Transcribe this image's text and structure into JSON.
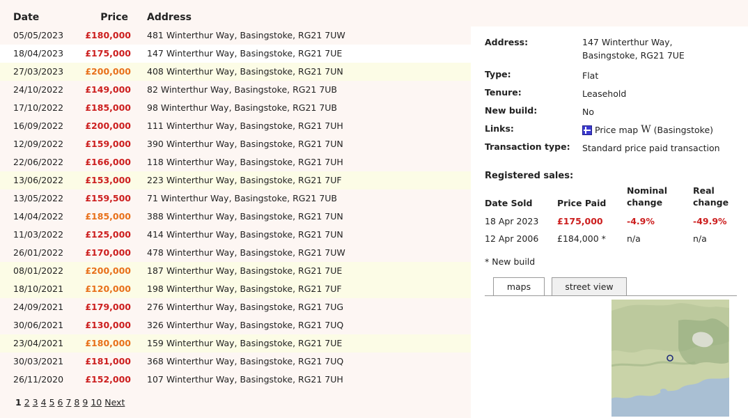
{
  "table": {
    "headers": {
      "date": "Date",
      "price": "Price",
      "address": "Address"
    },
    "rows": [
      {
        "date": "05/05/2023",
        "price": "£180,000",
        "address": "481 Winterthur Way, Basingstoke, RG21 7UW",
        "price_color": "red"
      },
      {
        "date": "18/04/2023",
        "price": "£175,000",
        "address": "147 Winterthur Way, Basingstoke, RG21 7UE",
        "price_color": "red"
      },
      {
        "date": "27/03/2023",
        "price": "£200,000",
        "address": "408 Winterthur Way, Basingstoke, RG21 7UN",
        "price_color": "orange"
      },
      {
        "date": "24/10/2022",
        "price": "£149,000",
        "address": "82 Winterthur Way, Basingstoke, RG21 7UB",
        "price_color": "red"
      },
      {
        "date": "17/10/2022",
        "price": "£185,000",
        "address": "98 Winterthur Way, Basingstoke, RG21 7UB",
        "price_color": "red"
      },
      {
        "date": "16/09/2022",
        "price": "£200,000",
        "address": "111 Winterthur Way, Basingstoke, RG21 7UH",
        "price_color": "red"
      },
      {
        "date": "12/09/2022",
        "price": "£159,000",
        "address": "390 Winterthur Way, Basingstoke, RG21 7UN",
        "price_color": "red"
      },
      {
        "date": "22/06/2022",
        "price": "£166,000",
        "address": "118 Winterthur Way, Basingstoke, RG21 7UH",
        "price_color": "red"
      },
      {
        "date": "13/06/2022",
        "price": "£153,000",
        "address": "223 Winterthur Way, Basingstoke, RG21 7UF",
        "price_color": "red"
      },
      {
        "date": "13/05/2022",
        "price": "£159,500",
        "address": "71 Winterthur Way, Basingstoke, RG21 7UB",
        "price_color": "red"
      },
      {
        "date": "14/04/2022",
        "price": "£185,000",
        "address": "388 Winterthur Way, Basingstoke, RG21 7UN",
        "price_color": "orange"
      },
      {
        "date": "11/03/2022",
        "price": "£125,000",
        "address": "414 Winterthur Way, Basingstoke, RG21 7UN",
        "price_color": "red"
      },
      {
        "date": "26/01/2022",
        "price": "£170,000",
        "address": "478 Winterthur Way, Basingstoke, RG21 7UW",
        "price_color": "red"
      },
      {
        "date": "08/01/2022",
        "price": "£200,000",
        "address": "187 Winterthur Way, Basingstoke, RG21 7UE",
        "price_color": "orange"
      },
      {
        "date": "18/10/2021",
        "price": "£120,000",
        "address": "198 Winterthur Way, Basingstoke, RG21 7UF",
        "price_color": "orange"
      },
      {
        "date": "24/09/2021",
        "price": "£179,000",
        "address": "276 Winterthur Way, Basingstoke, RG21 7UG",
        "price_color": "red"
      },
      {
        "date": "30/06/2021",
        "price": "£130,000",
        "address": "326 Winterthur Way, Basingstoke, RG21 7UQ",
        "price_color": "red"
      },
      {
        "date": "23/04/2021",
        "price": "£180,000",
        "address": "159 Winterthur Way, Basingstoke, RG21 7UE",
        "price_color": "orange"
      },
      {
        "date": "30/03/2021",
        "price": "£181,000",
        "address": "368 Winterthur Way, Basingstoke, RG21 7UQ",
        "price_color": "red"
      },
      {
        "date": "26/11/2020",
        "price": "£152,000",
        "address": "107 Winterthur Way, Basingstoke, RG21 7UH",
        "price_color": "red"
      }
    ],
    "selected_row_index": 1,
    "highlighted_row_indices": [
      2,
      8,
      13,
      14,
      17
    ]
  },
  "pagination": {
    "pages": [
      "1",
      "2",
      "3",
      "4",
      "5",
      "6",
      "7",
      "8",
      "9",
      "10"
    ],
    "current": "1",
    "next_label": "Next"
  },
  "detail": {
    "address_label": "Address:",
    "address_line1": "147 Winterthur Way,",
    "address_line2": "Basingstoke, RG21 7UE",
    "type_label": "Type:",
    "type_value": "Flat",
    "tenure_label": "Tenure:",
    "tenure_value": "Leasehold",
    "newbuild_label": "New build:",
    "newbuild_value": "No",
    "links_label": "Links:",
    "links_price_map": "Price map",
    "links_wiki": "(Basingstoke)",
    "wiki_glyph": "W",
    "transaction_label": "Transaction type:",
    "transaction_value": "Standard price paid transaction",
    "registered_sales_title": "Registered sales:",
    "sales_headers": {
      "date_sold": "Date Sold",
      "price_paid": "Price Paid",
      "nominal_1": "Nominal",
      "nominal_2": "change",
      "real_1": "Real",
      "real_2": "change"
    },
    "sales": [
      {
        "date": "18 Apr 2023",
        "price": "£175,000",
        "nominal": "-4.9%",
        "real": "-49.9%",
        "highlight": true
      },
      {
        "date": "12 Apr 2006",
        "price": "£184,000 *",
        "nominal": "n/a",
        "real": "n/a",
        "highlight": false
      }
    ],
    "new_build_note": "* New build"
  },
  "tabs": {
    "maps": "maps",
    "street_view": "street view"
  },
  "colors": {
    "price_red": "#cc1e1e",
    "price_orange": "#e8701a",
    "page_bg": "#fdf6f3",
    "highlight_row": "#fcfce6"
  }
}
